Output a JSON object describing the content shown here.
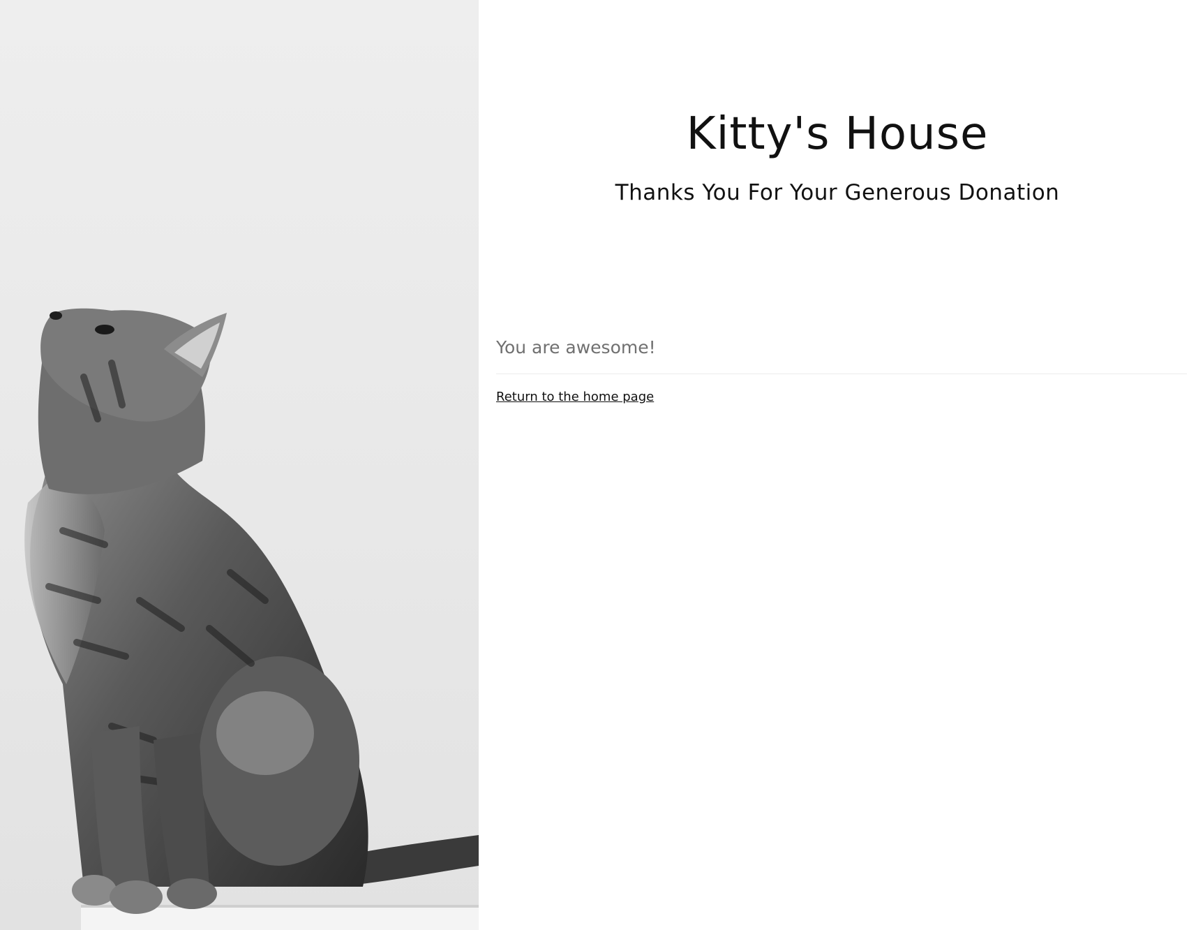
{
  "brand": {
    "title": "Kitty's House",
    "subtitle": "Thanks You For Your Generous Donation"
  },
  "confirmation": {
    "message": "You are awesome!",
    "home_link_label": "Return to the home page"
  },
  "photo": {
    "icon": "cat-photo",
    "style": "black-and-white"
  },
  "colors": {
    "heading": "#111111",
    "message": "#707070",
    "divider": "#ececec",
    "background": "#ffffff"
  }
}
